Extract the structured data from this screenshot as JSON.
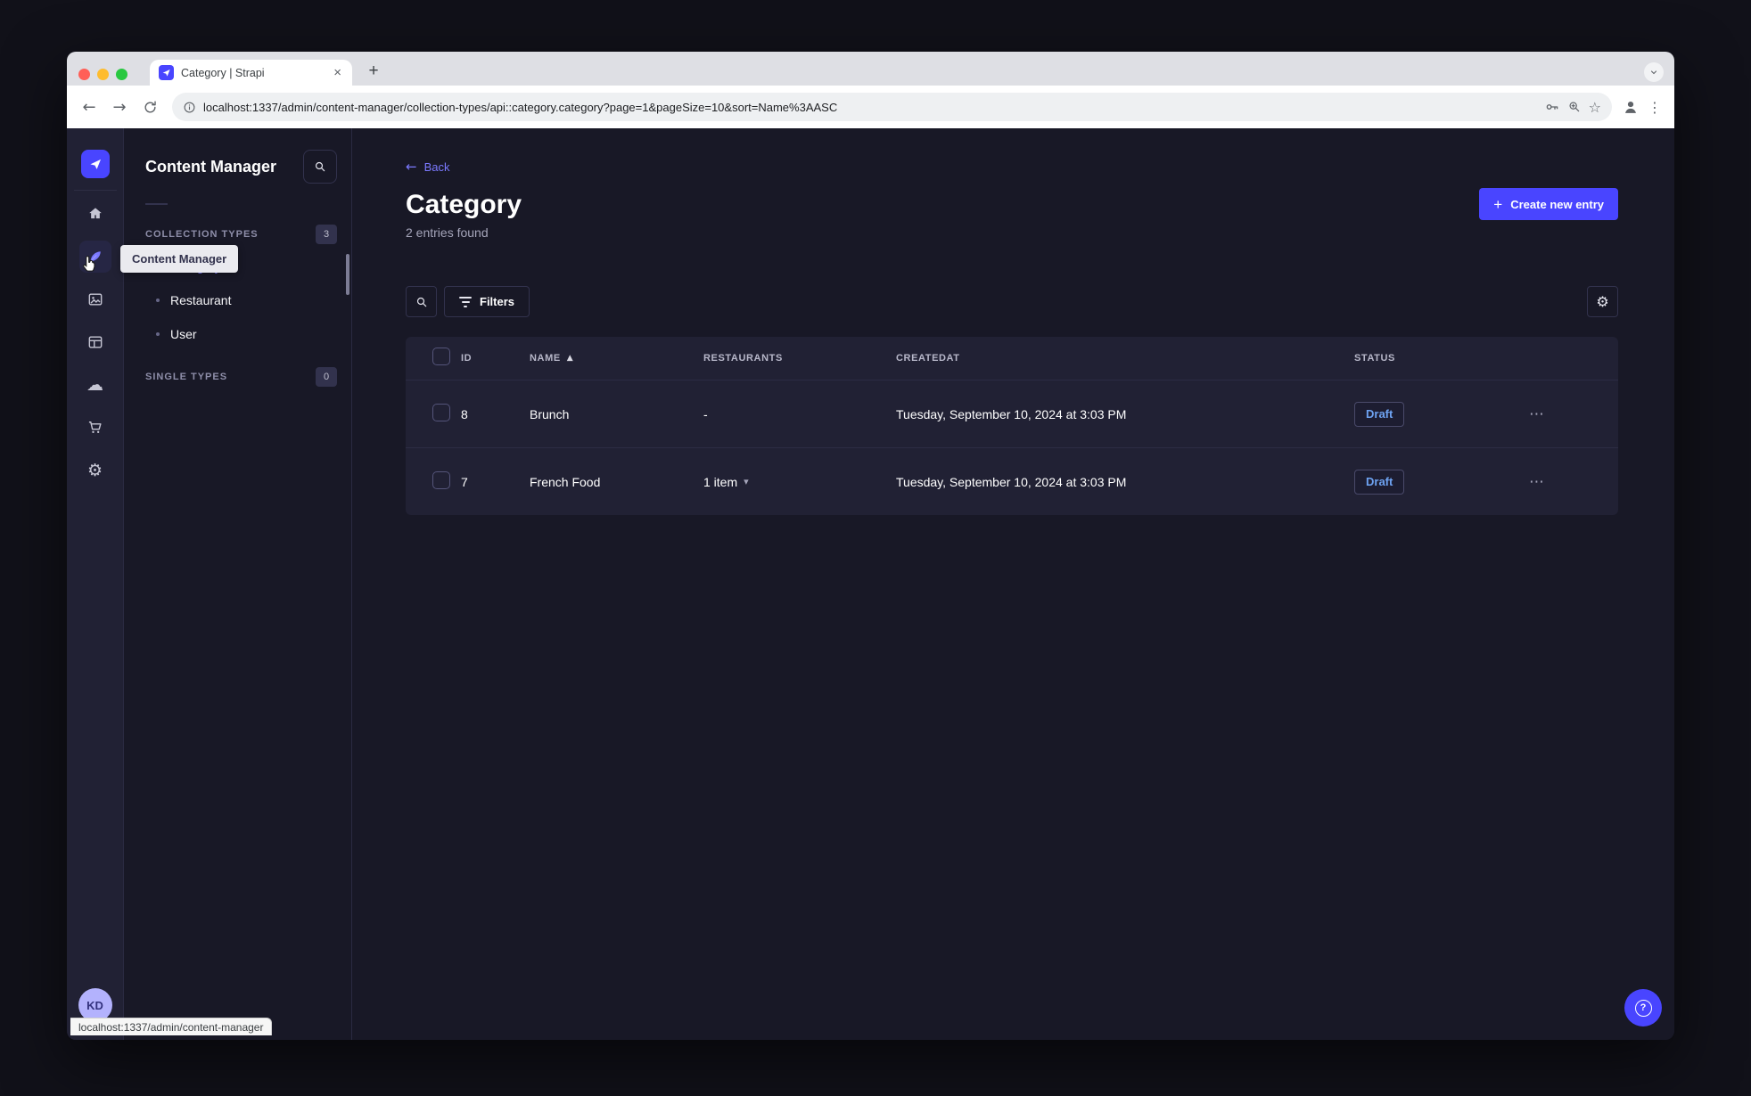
{
  "browser": {
    "tab_title": "Category | Strapi",
    "url": "localhost:1337/admin/content-manager/collection-types/api::category.category?page=1&pageSize=10&sort=Name%3AASC",
    "status_bar_url": "localhost:1337/admin/content-manager"
  },
  "icons": {
    "back_arrow": "←",
    "forward_arrow": "→",
    "close": "×",
    "plus": "+",
    "star": "☆",
    "kebab": "⋮",
    "more": "⋯",
    "sort_asc": "▲",
    "caret_down": "▾",
    "gear": "⚙",
    "cloud": "☁",
    "question": "?"
  },
  "sidebar": {
    "avatar_initials": "KD",
    "tooltip": "Content Manager"
  },
  "subnav": {
    "title": "Content Manager",
    "sections": [
      {
        "label": "COLLECTION TYPES",
        "count": "3",
        "items": [
          {
            "label": "Category"
          },
          {
            "label": "Restaurant"
          },
          {
            "label": "User"
          }
        ]
      },
      {
        "label": "SINGLE TYPES",
        "count": "0",
        "items": []
      }
    ]
  },
  "main": {
    "back_label": "Back",
    "title": "Category",
    "subtitle": "2 entries found",
    "create_button": "Create new entry",
    "filters_button": "Filters",
    "table": {
      "columns": [
        "ID",
        "NAME",
        "RESTAURANTS",
        "CREATEDAT",
        "STATUS"
      ],
      "rows": [
        {
          "id": "8",
          "name": "Brunch",
          "restaurants": "-",
          "created_at": "Tuesday, September 10, 2024 at 3:03 PM",
          "status": "Draft"
        },
        {
          "id": "7",
          "name": "French Food",
          "restaurants": "1 item",
          "created_at": "Tuesday, September 10, 2024 at 3:03 PM",
          "status": "Draft"
        }
      ]
    }
  },
  "colors": {
    "accent": "#4945FF",
    "accent_light": "#7B79FF",
    "draft_status": "#6EA3F2",
    "app_background": "#181826",
    "panel_background": "#212134"
  }
}
